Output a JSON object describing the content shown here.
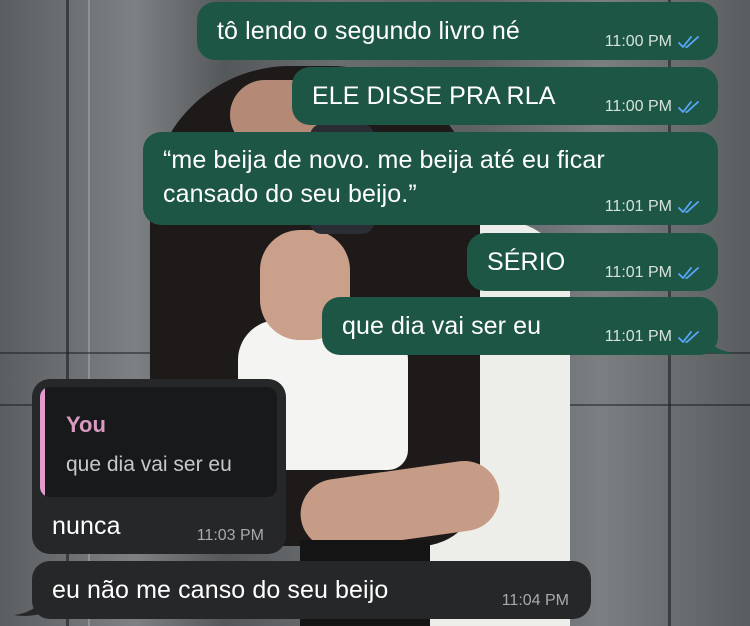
{
  "colors": {
    "outgoing_bubble": "#1e5646",
    "incoming_bubble": "#262729",
    "reply_accent": "#e29ac8",
    "read_ticks": "#58a8f7"
  },
  "messages": [
    {
      "direction": "outgoing",
      "text": "tô lendo o segundo livro né",
      "time": "11:00 PM",
      "status": "read",
      "status_icon": "double-check-icon"
    },
    {
      "direction": "outgoing",
      "text": "ELE DISSE PRA RLA",
      "time": "11:00 PM",
      "status": "read",
      "status_icon": "double-check-icon"
    },
    {
      "direction": "outgoing",
      "text_lines": [
        "“me beija de novo. me beija até eu ficar",
        "cansado do seu beijo.”"
      ],
      "time": "11:01 PM",
      "status": "read",
      "status_icon": "double-check-icon"
    },
    {
      "direction": "outgoing",
      "text": "SÉRIO",
      "time": "11:01 PM",
      "status": "read",
      "status_icon": "double-check-icon"
    },
    {
      "direction": "outgoing",
      "text": "que dia vai ser eu",
      "time": "11:01 PM",
      "status": "read",
      "status_icon": "double-check-icon"
    },
    {
      "direction": "incoming",
      "reply_to": {
        "author": "You",
        "text": "que dia vai ser eu"
      },
      "text": "nunca",
      "time": "11:03 PM"
    },
    {
      "direction": "incoming",
      "text": "eu não me canso do seu beijo",
      "time": "11:04 PM"
    }
  ]
}
